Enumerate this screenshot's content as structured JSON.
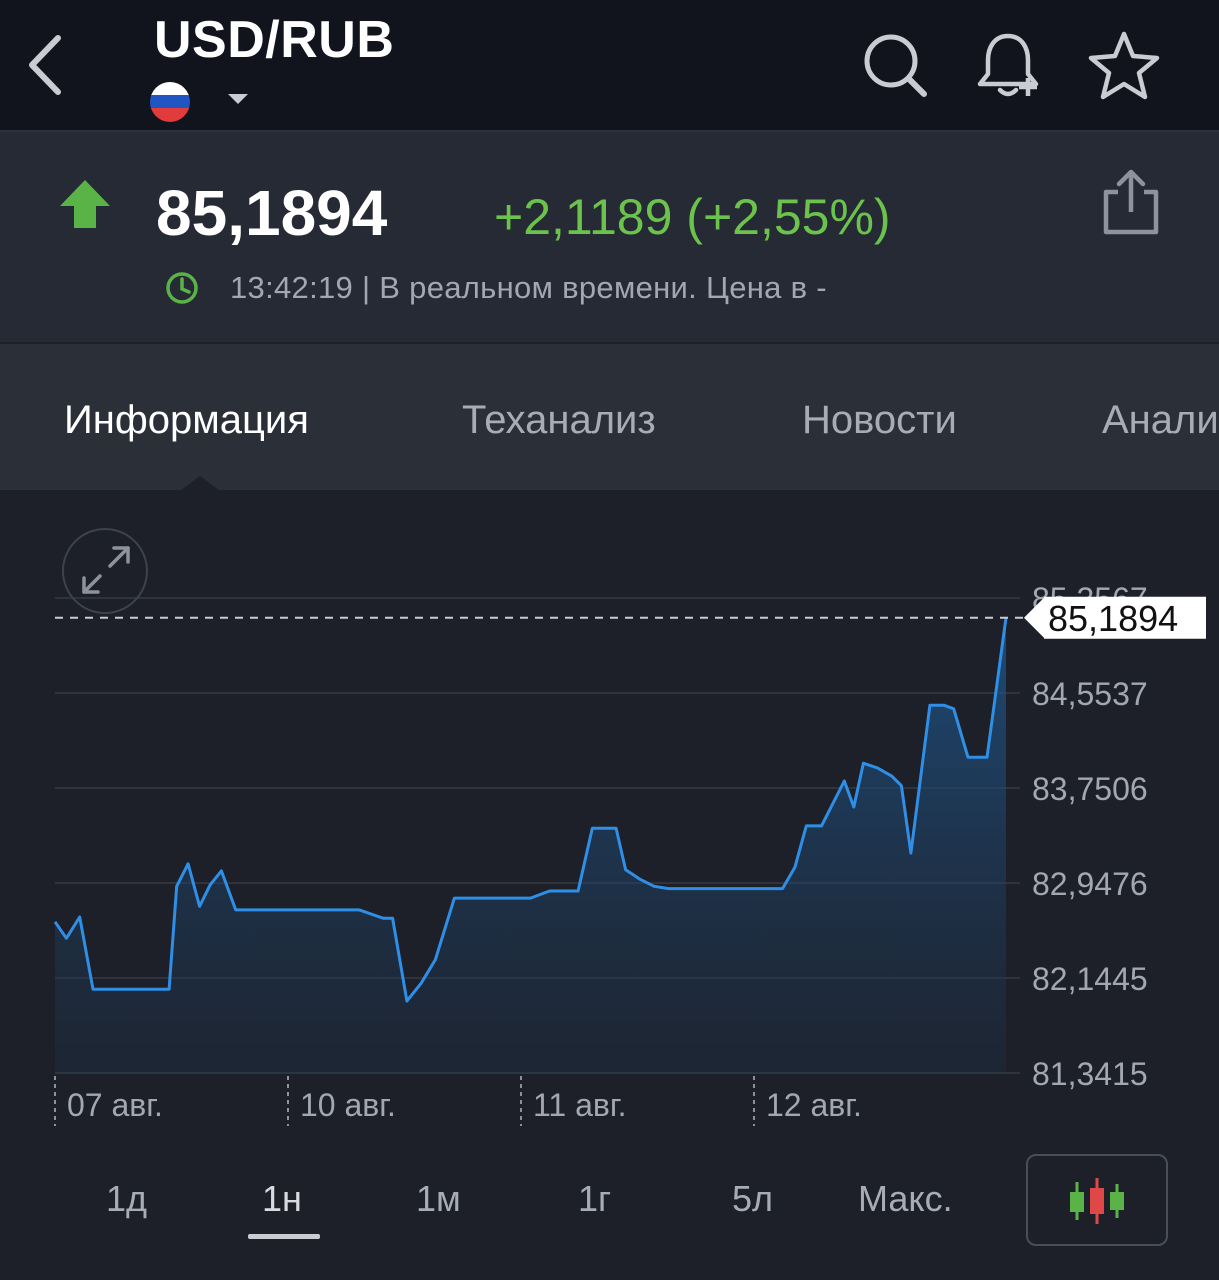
{
  "header": {
    "title": "USD/RUB",
    "flag_icon": "russia-flag-icon",
    "back_icon": "chevron-left-icon",
    "search_icon": "search-icon",
    "alert_icon": "bell-plus-icon",
    "favorite_icon": "star-icon"
  },
  "quote": {
    "price": "85,1894",
    "change": "+2,1189 (+2,55%)",
    "direction": "up",
    "time": "13:42:19",
    "status": "| В реальном времени. Цена в -",
    "up_color": "#5ab346",
    "change_color": "#6bc34b"
  },
  "tabs": [
    {
      "label": "Информация",
      "active": true
    },
    {
      "label": "Теханализ",
      "active": false
    },
    {
      "label": "Новости",
      "active": false
    },
    {
      "label": "Анали",
      "active": false
    }
  ],
  "chart_data": {
    "type": "area",
    "line_color": "#2f8fe6",
    "y_ticks": [
      "85,3567",
      "84,5537",
      "83,7506",
      "82,9476",
      "82,1445",
      "81,3415"
    ],
    "ylim": [
      81.3415,
      85.3567
    ],
    "current_value_label": "85,1894",
    "current_value": 85.1894,
    "x_tick_labels": [
      "07 авг.",
      "10 авг.",
      "11 авг.",
      "12 авг."
    ],
    "x_tick_positions": [
      0,
      0.245,
      0.49,
      0.735
    ],
    "x": [
      0,
      0.012,
      0.026,
      0.04,
      0.06,
      0.08,
      0.1,
      0.12,
      0.128,
      0.14,
      0.152,
      0.163,
      0.175,
      0.19,
      0.205,
      0.22,
      0.24,
      0.26,
      0.28,
      0.3,
      0.32,
      0.345,
      0.355,
      0.37,
      0.385,
      0.4,
      0.42,
      0.44,
      0.46,
      0.48,
      0.5,
      0.52,
      0.55,
      0.565,
      0.59,
      0.6,
      0.615,
      0.63,
      0.645,
      0.665,
      0.68,
      0.7,
      0.72,
      0.74,
      0.765,
      0.778,
      0.79,
      0.806,
      0.818,
      0.83,
      0.84,
      0.85,
      0.865,
      0.88,
      0.89,
      0.9,
      0.92,
      0.935,
      0.945,
      0.96,
      0.97,
      0.98,
      1.0
    ],
    "values": [
      82.62,
      82.48,
      82.66,
      82.05,
      82.05,
      82.05,
      82.05,
      82.05,
      82.92,
      83.11,
      82.75,
      82.93,
      83.05,
      82.72,
      82.72,
      82.72,
      82.72,
      82.72,
      82.72,
      82.72,
      82.72,
      82.65,
      82.65,
      81.95,
      82.1,
      82.3,
      82.82,
      82.82,
      82.82,
      82.82,
      82.82,
      82.88,
      82.88,
      83.41,
      83.41,
      83.06,
      82.98,
      82.92,
      82.9,
      82.9,
      82.9,
      82.9,
      82.9,
      82.9,
      82.9,
      83.08,
      83.43,
      83.43,
      83.62,
      83.81,
      83.59,
      83.96,
      83.92,
      83.85,
      83.77,
      83.2,
      84.45,
      84.45,
      84.42,
      84.01,
      84.01,
      84.01,
      85.19
    ]
  },
  "time_ranges": [
    {
      "label": "1д",
      "active": false
    },
    {
      "label": "1н",
      "active": true
    },
    {
      "label": "1м",
      "active": false
    },
    {
      "label": "1г",
      "active": false
    },
    {
      "label": "5л",
      "active": false
    },
    {
      "label": "Макс.",
      "active": false
    }
  ],
  "controls": {
    "expand_icon": "expand-arrows-icon",
    "chart_type_icon": "candlestick-icon",
    "share_icon": "share-icon",
    "clock_icon": "clock-icon"
  }
}
